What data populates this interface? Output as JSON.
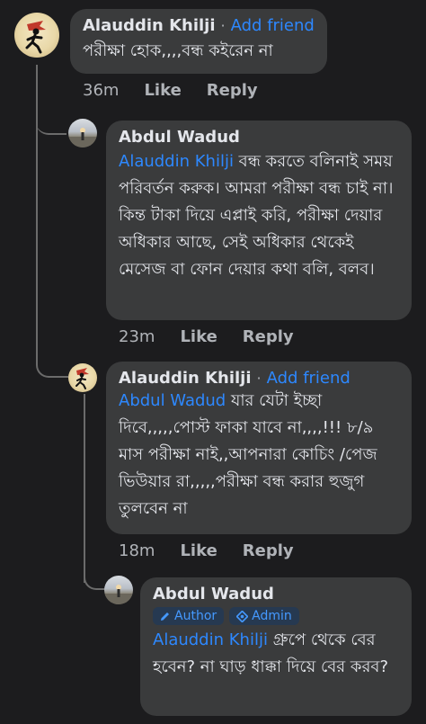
{
  "comments": [
    {
      "author": "Alauddin Khilji",
      "separator": "·",
      "action": "Add friend",
      "text": "পরীক্ষা হোক,,,,বন্ধ কইরেন না",
      "time": "36m",
      "like": "Like",
      "reply": "Reply"
    },
    {
      "author": "Abdul Wadud",
      "mention": "Alauddin Khilji",
      "text_line1": " বন্ধ করতে বলিনাই",
      "text_rest": "সময় পরিবর্তন করুক। আমরা পরীক্ষা বন্ধ চাই না। কিন্ত টাকা দিয়ে এপ্লাই করি, পরীক্ষা দেয়ার অধিকার আছে, সেই অধিকার থেকেই মেসেজ বা ফোন দেয়ার কথা বলি, বলব।",
      "time": "23m",
      "like": "Like",
      "reply": "Reply"
    },
    {
      "author": "Alauddin Khilji",
      "separator": "·",
      "action": "Add friend",
      "mention": "Abdul Wadud",
      "text_line1": " যার যেটা ইচ্ছা",
      "text_rest": "দিবে,,,,,পোস্ট ফাকা যাবে না,,,,!!! ৮/৯ মাস পরীক্ষা নাই,,আপনারা কোচিং /পেজ ভিউয়ার রা,,,,,পরীক্ষা বন্ধ করার হুজুগ তুলবেন না",
      "time": "18m",
      "like": "Like",
      "reply": "Reply"
    },
    {
      "author": "Abdul Wadud",
      "badge_author": "Author",
      "badge_admin": "Admin",
      "mention": "Alauddin Khilji",
      "text_line1": " গ্রুপে থেকে",
      "text_rest": "বের হবেন? না ঘাড় ধাক্কা দিয়ে বের করব?"
    }
  ],
  "colors": {
    "background": "#1c1c1e",
    "bubble": "#3a3b3c",
    "link": "#2d88ff",
    "meta": "#b0b3b8"
  }
}
